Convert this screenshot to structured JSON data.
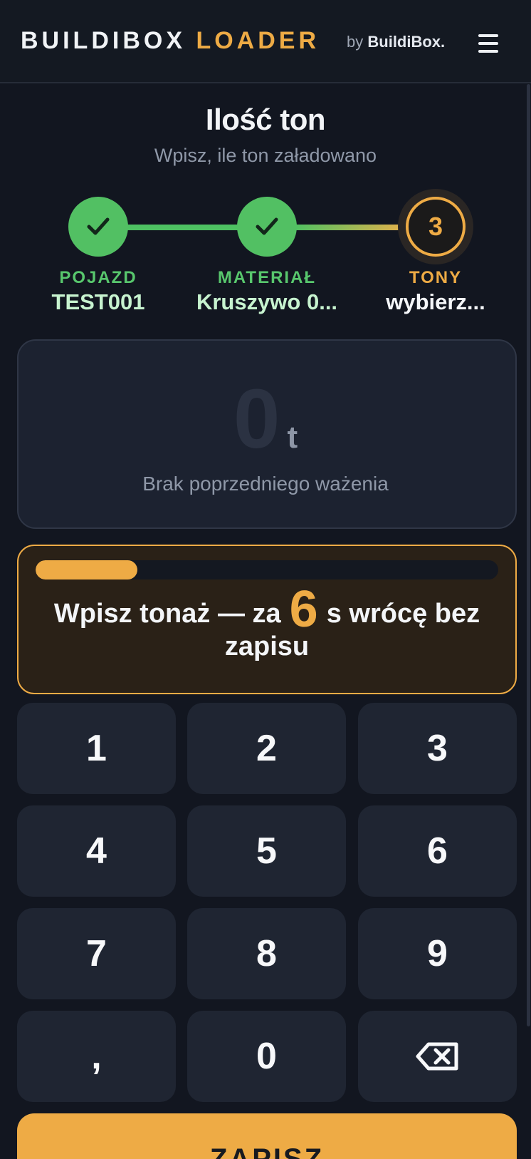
{
  "header": {
    "brand_primary": "BUILDIBOX",
    "brand_accent": "LOADER",
    "by_prefix": "by",
    "by_name": "BuildiBox.",
    "menu_icon": "hamburger-menu-icon"
  },
  "page": {
    "title": "Ilość ton",
    "subtitle": "Wpisz, ile ton załadowano"
  },
  "stepper": {
    "steps": [
      {
        "label": "POJAZD",
        "value": "TEST001",
        "status": "done",
        "icon": "check-icon"
      },
      {
        "label": "MATERIAŁ",
        "value": "Kruszywo 0...",
        "status": "done",
        "icon": "check-icon"
      },
      {
        "label": "TONY",
        "value": "wybierz...",
        "status": "active",
        "number": "3"
      }
    ]
  },
  "display": {
    "value": "0",
    "unit": "t",
    "note": "Brak poprzedniego ważenia"
  },
  "timeout": {
    "text_before": "Wpisz tonaż — za",
    "seconds": "6",
    "text_after": "s wrócę bez zapisu",
    "progress_percent": 22
  },
  "keypad": {
    "keys": [
      "1",
      "2",
      "3",
      "4",
      "5",
      "6",
      "7",
      "8",
      "9",
      ",",
      "0"
    ],
    "backspace_icon": "backspace-icon"
  },
  "save": {
    "label": "ZAPISZ"
  },
  "colors": {
    "accent": "#eeab45",
    "success": "#52c063",
    "background": "#121620",
    "card": "#1c2230"
  }
}
